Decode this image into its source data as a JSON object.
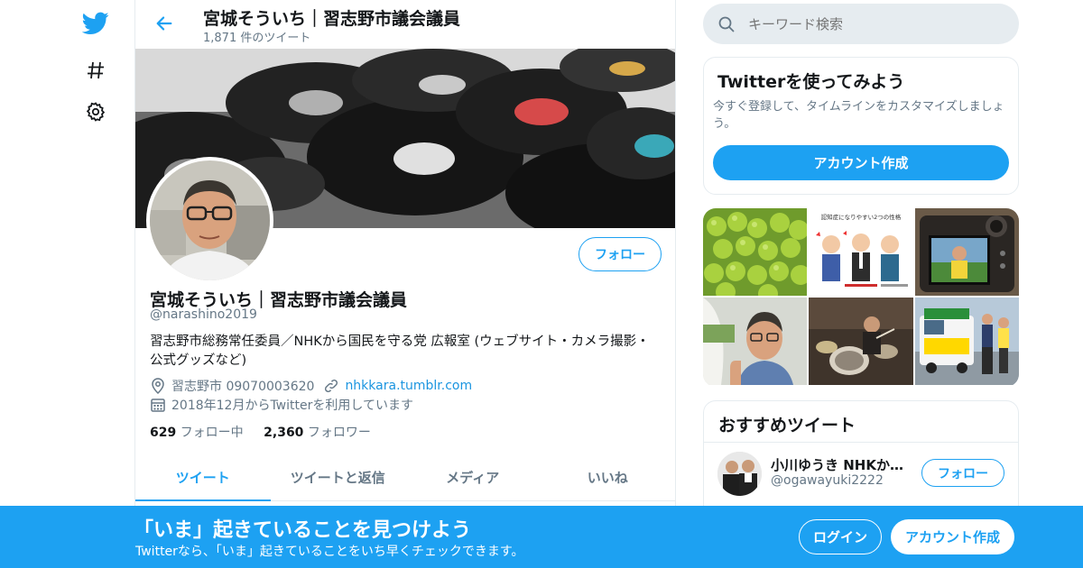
{
  "colors": {
    "accent": "#1da1f2",
    "text": "#14171a",
    "secondary": "#657786",
    "border": "#e6ecf0"
  },
  "nav": {
    "icons": [
      "twitter-logo-icon",
      "hashtag-icon",
      "gear-icon"
    ]
  },
  "header": {
    "title": "宮城そういち｜習志野市議会議員",
    "tweet_count": "1,871 件のツイート"
  },
  "profile": {
    "follow_label": "フォロー",
    "name": "宮城そういち｜習志野市議会議員",
    "handle": "@narashino2019",
    "bio": "習志野市総務常任委員／NHKから国民を守る党 広報室 (ウェブサイト・カメラ撮影・公式グッズなど)",
    "location": "習志野市 09070003620",
    "website": "nhkkara.tumblr.com",
    "joined": "2018年12月からTwitterを利用しています",
    "following_count": "629",
    "following_label": "フォロー中",
    "followers_count": "2,360",
    "followers_label": "フォロワー"
  },
  "tabs": [
    {
      "label": "ツイート",
      "active": true
    },
    {
      "label": "ツイートと返信",
      "active": false
    },
    {
      "label": "メディア",
      "active": false
    },
    {
      "label": "いいね",
      "active": false
    }
  ],
  "search": {
    "placeholder": "キーワード検索"
  },
  "signup_card": {
    "title": "Twitterを使ってみよう",
    "description": "今すぐ登録して、タイムラインをカスタマイズしましょう。",
    "button": "アカウント作成"
  },
  "media_thumbnails": [
    {
      "caption": ""
    },
    {
      "caption": "認知症になりやすい2つの性格"
    },
    {
      "caption": ""
    },
    {
      "caption": ""
    },
    {
      "caption": ""
    },
    {
      "caption": ""
    }
  ],
  "recommended": {
    "title": "おすすめツイート",
    "name": "小川ゆうき NHKから国民を守る党",
    "handle": "@ogawayuki2222",
    "follow_label": "フォロー"
  },
  "bottom_bar": {
    "title": "「いま」起きていることを見つけよう",
    "subtitle": "Twitterなら、「いま」起きていることをいち早くチェックできます。",
    "login": "ログイン",
    "signup": "アカウント作成"
  }
}
